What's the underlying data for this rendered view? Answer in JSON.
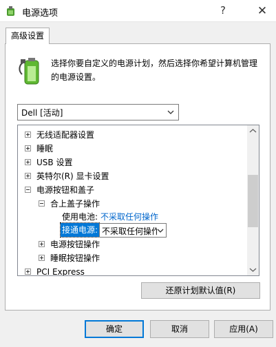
{
  "window": {
    "title": "电源选项",
    "help_glyph": "?",
    "close_glyph": "✕"
  },
  "tab": {
    "label": "高级设置"
  },
  "description": "选择你要自定义的电源计划，然后选择你希望计算机管理的电源设置。",
  "plan_select": {
    "value": "Dell [活动]"
  },
  "tree": {
    "items": [
      {
        "label": "无线适配器设置",
        "state": "collapsed"
      },
      {
        "label": "睡眠",
        "state": "collapsed"
      },
      {
        "label": "USB 设置",
        "state": "collapsed"
      },
      {
        "label": "英特尔(R) 显卡设置",
        "state": "collapsed"
      },
      {
        "label": "电源按钮和盖子",
        "state": "expanded"
      },
      {
        "label": "合上盖子操作",
        "state": "expanded"
      },
      {
        "label": "电源按钮操作",
        "state": "collapsed"
      },
      {
        "label": "睡眠按钮操作",
        "state": "collapsed"
      },
      {
        "label": "PCI Express",
        "state": "collapsed"
      }
    ],
    "on_battery": {
      "label": "使用电池:",
      "value": "不采取任何操作"
    },
    "plugged_in": {
      "label": "接通电源:",
      "value": "不采取任何操作"
    }
  },
  "buttons": {
    "restore": "还原计划默认值(R)",
    "ok": "确定",
    "cancel": "取消",
    "apply": "应用(A)"
  },
  "colors": {
    "accent": "#0078d7",
    "link": "#0066cc",
    "battery_green": "#5fb832"
  },
  "icons": {
    "app": "power-options-icon",
    "plan": "battery-plug-icon"
  }
}
